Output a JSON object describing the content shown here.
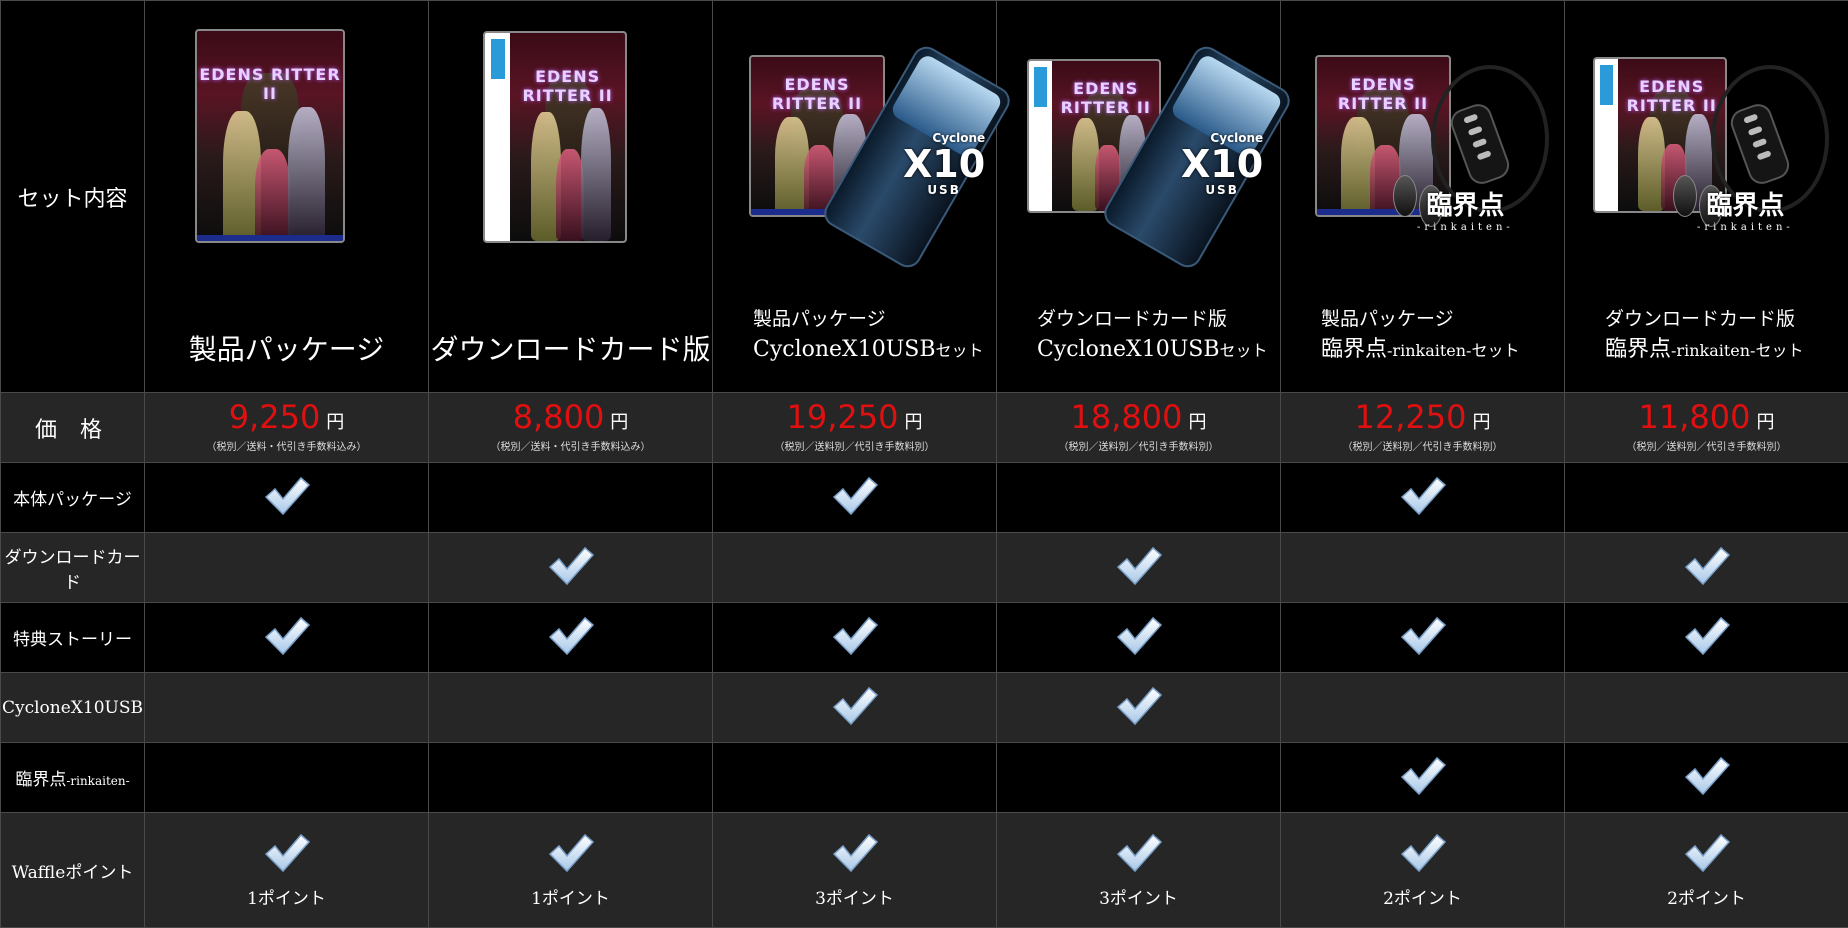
{
  "row_labels": {
    "set_contents": "セット内容",
    "price": "価 格",
    "package": "本体パッケージ",
    "download_card": "ダウンロードカード",
    "bonus_story": "特典ストーリー",
    "cyclone_pre": "CycloneX10USB",
    "rinkaiten_main": "臨界点",
    "rinkaiten_suffix": "-rinkaiten-",
    "waffle": "Waffleポイント"
  },
  "logo_text": "EDENS RITTER II",
  "cyclone_text": {
    "brand": "Cyclone",
    "big": "X10",
    "usb": "USB"
  },
  "rinkaiten_text": {
    "big": "臨界点",
    "sub": "-rinkaiten-"
  },
  "yen": "円",
  "products": [
    {
      "title": "製品パッケージ",
      "price": "9,250",
      "note": "（税別／送料・代引き手数料込み）",
      "points": "1ポイント"
    },
    {
      "title": "ダウンロードカード版",
      "price": "8,800",
      "note": "（税別／送料・代引き手数料込み）",
      "points": "1ポイント"
    },
    {
      "title_l1": "製品パッケージ",
      "title_l2": "CycloneX10USB",
      "title_suffix": "セット",
      "price": "19,250",
      "note": "（税別／送料別／代引き手数料別）",
      "points": "3ポイント"
    },
    {
      "title_l1": "ダウンロードカード版",
      "title_l2": "CycloneX10USB",
      "title_suffix": "セット",
      "price": "18,800",
      "note": "（税別／送料別／代引き手数料別）",
      "points": "3ポイント"
    },
    {
      "title_l1": "製品パッケージ",
      "title_l2": "臨界点",
      "title_suffix": "-rinkaiten-セット",
      "price": "12,250",
      "note": "（税別／送料別／代引き手数料別）",
      "points": "2ポイント"
    },
    {
      "title_l1": "ダウンロードカード版",
      "title_l2": "臨界点",
      "title_suffix": "-rinkaiten-セット",
      "price": "11,800",
      "note": "（税別／送料別／代引き手数料別）",
      "points": "2ポイント"
    }
  ],
  "matrix": {
    "package": [
      true,
      false,
      true,
      false,
      true,
      false
    ],
    "download_card": [
      false,
      true,
      false,
      true,
      false,
      true
    ],
    "bonus_story": [
      true,
      true,
      true,
      true,
      true,
      true
    ],
    "cyclone": [
      false,
      false,
      true,
      true,
      false,
      false
    ],
    "rinkaiten": [
      false,
      false,
      false,
      false,
      true,
      true
    ],
    "waffle": [
      true,
      true,
      true,
      true,
      true,
      true
    ]
  },
  "colors": {
    "price": "#e01010",
    "row_dark": "#000000",
    "row_light": "#262626",
    "border": "#4a4a4a"
  },
  "icons": {
    "check": "checkmark-icon"
  }
}
